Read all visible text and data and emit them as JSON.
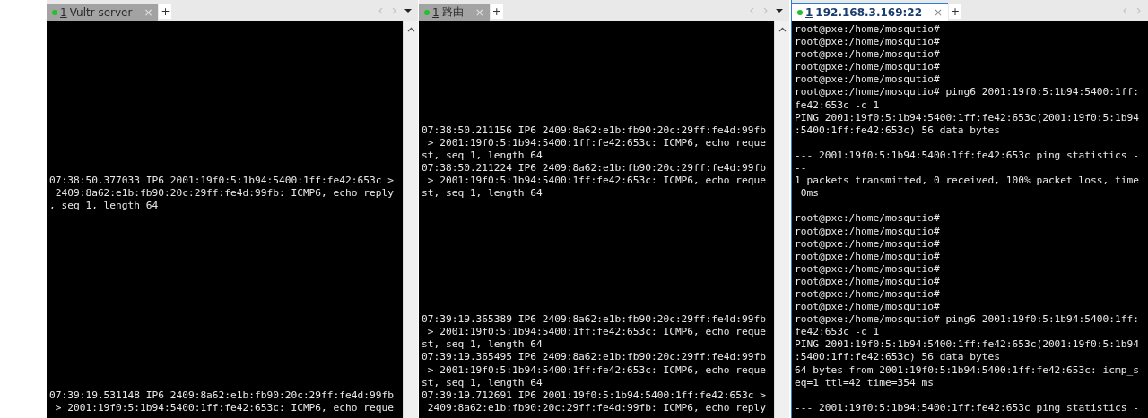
{
  "panes": [
    {
      "tab": {
        "number": "1",
        "label": "Vultr server",
        "selected": false,
        "connected": true,
        "close": "×"
      },
      "new_tab": "+",
      "has_scrollbar": true,
      "has_menu": true,
      "lines": [
        {
          "kind": "blank"
        },
        {
          "kind": "blank"
        },
        {
          "kind": "blank"
        },
        {
          "kind": "blank"
        },
        {
          "kind": "blank"
        },
        {
          "kind": "blank"
        },
        {
          "kind": "blank"
        },
        {
          "kind": "blank"
        },
        {
          "kind": "blank"
        },
        {
          "kind": "blank"
        },
        {
          "kind": "blank"
        },
        {
          "kind": "blank"
        },
        {
          "kind": "text",
          "text": "07:38:50.377033 IP6 2001:19f0:5:1b94:5400:1ff:fe42:653c >"
        },
        {
          "kind": "text",
          "text": " 2409:8a62:e1b:fb90:20c:29ff:fe4d:99fb: ICMP6, echo reply"
        },
        {
          "kind": "text",
          "text": ", seq 1, length 64"
        },
        {
          "kind": "blank"
        },
        {
          "kind": "blank"
        },
        {
          "kind": "blank"
        },
        {
          "kind": "blank"
        },
        {
          "kind": "blank"
        },
        {
          "kind": "blank"
        },
        {
          "kind": "blank"
        },
        {
          "kind": "blank"
        },
        {
          "kind": "blank"
        },
        {
          "kind": "blank"
        },
        {
          "kind": "blank"
        },
        {
          "kind": "blank"
        },
        {
          "kind": "blank"
        },
        {
          "kind": "blank"
        },
        {
          "kind": "text",
          "text": "07:39:19.531148 IP6 2409:8a62:e1b:fb90:20c:29ff:fe4d:99fb"
        },
        {
          "kind": "text",
          "text": " > 2001:19f0:5:1b94:5400:1ff:fe42:653c: ICMP6, echo reque"
        }
      ]
    },
    {
      "tab": {
        "number": "1",
        "label": "路由",
        "selected": false,
        "connected": true,
        "close": "×"
      },
      "new_tab": "+",
      "has_scrollbar": true,
      "has_menu": true,
      "lines": [
        {
          "kind": "blank"
        },
        {
          "kind": "blank"
        },
        {
          "kind": "blank"
        },
        {
          "kind": "blank"
        },
        {
          "kind": "blank"
        },
        {
          "kind": "blank"
        },
        {
          "kind": "blank"
        },
        {
          "kind": "blank"
        },
        {
          "kind": "text",
          "text": "07:38:50.211156 IP6 2409:8a62:e1b:fb90:20c:29ff:fe4d:99fb"
        },
        {
          "kind": "text",
          "text": " > 2001:19f0:5:1b94:5400:1ff:fe42:653c: ICMP6, echo reque"
        },
        {
          "kind": "text",
          "text": "st, seq 1, length 64"
        },
        {
          "kind": "text",
          "text": "07:38:50.211224 IP6 2409:8a62:e1b:fb90:20c:29ff:fe4d:99fb"
        },
        {
          "kind": "text",
          "text": " > 2001:19f0:5:1b94:5400:1ff:fe42:653c: ICMP6, echo reque"
        },
        {
          "kind": "text",
          "text": "st, seq 1, length 64"
        },
        {
          "kind": "blank"
        },
        {
          "kind": "blank"
        },
        {
          "kind": "blank"
        },
        {
          "kind": "blank"
        },
        {
          "kind": "blank"
        },
        {
          "kind": "blank"
        },
        {
          "kind": "blank"
        },
        {
          "kind": "blank"
        },
        {
          "kind": "blank"
        },
        {
          "kind": "text",
          "text": "07:39:19.365389 IP6 2409:8a62:e1b:fb90:20c:29ff:fe4d:99fb"
        },
        {
          "kind": "text",
          "text": " > 2001:19f0:5:1b94:5400:1ff:fe42:653c: ICMP6, echo reque"
        },
        {
          "kind": "text",
          "text": "st, seq 1, length 64"
        },
        {
          "kind": "text",
          "text": "07:39:19.365495 IP6 2409:8a62:e1b:fb90:20c:29ff:fe4d:99fb"
        },
        {
          "kind": "text",
          "text": " > 2001:19f0:5:1b94:5400:1ff:fe42:653c: ICMP6, echo reque"
        },
        {
          "kind": "text",
          "text": "st, seq 1, length 64"
        },
        {
          "kind": "text",
          "text": "07:39:19.712691 IP6 2001:19f0:5:1b94:5400:1ff:fe42:653c >"
        },
        {
          "kind": "text",
          "text": " 2409:8a62:e1b:fb90:20c:29ff:fe4d:99fb: ICMP6, echo reply"
        }
      ]
    },
    {
      "tab": {
        "number": "1",
        "label": "192.168.3.169:22",
        "selected": true,
        "connected": true,
        "close": "×"
      },
      "new_tab": "+",
      "has_scrollbar": false,
      "has_menu": false,
      "lines": [
        {
          "kind": "text",
          "text": "root@pxe:/home/mosqutio#"
        },
        {
          "kind": "text",
          "text": "root@pxe:/home/mosqutio#"
        },
        {
          "kind": "text",
          "text": "root@pxe:/home/mosqutio#"
        },
        {
          "kind": "text",
          "text": "root@pxe:/home/mosqutio#"
        },
        {
          "kind": "text",
          "text": "root@pxe:/home/mosqutio#"
        },
        {
          "kind": "text",
          "text": "root@pxe:/home/mosqutio# ping6 2001:19f0:5:1b94:5400:1ff:"
        },
        {
          "kind": "text",
          "text": "fe42:653c -c 1"
        },
        {
          "kind": "text",
          "text": "PING 2001:19f0:5:1b94:5400:1ff:fe42:653c(2001:19f0:5:1b94"
        },
        {
          "kind": "text",
          "text": ":5400:1ff:fe42:653c) 56 data bytes"
        },
        {
          "kind": "blank"
        },
        {
          "kind": "text",
          "text": "--- 2001:19f0:5:1b94:5400:1ff:fe42:653c ping statistics -"
        },
        {
          "kind": "text",
          "text": "--"
        },
        {
          "kind": "text",
          "text": "1 packets transmitted, 0 received, 100% packet loss, time"
        },
        {
          "kind": "text",
          "text": " 0ms"
        },
        {
          "kind": "blank"
        },
        {
          "kind": "text",
          "text": "root@pxe:/home/mosqutio#"
        },
        {
          "kind": "text",
          "text": "root@pxe:/home/mosqutio#"
        },
        {
          "kind": "text",
          "text": "root@pxe:/home/mosqutio#"
        },
        {
          "kind": "text",
          "text": "root@pxe:/home/mosqutio#"
        },
        {
          "kind": "text",
          "text": "root@pxe:/home/mosqutio#"
        },
        {
          "kind": "text",
          "text": "root@pxe:/home/mosqutio#"
        },
        {
          "kind": "text",
          "text": "root@pxe:/home/mosqutio#"
        },
        {
          "kind": "text",
          "text": "root@pxe:/home/mosqutio#"
        },
        {
          "kind": "text",
          "text": "root@pxe:/home/mosqutio# ping6 2001:19f0:5:1b94:5400:1ff:"
        },
        {
          "kind": "text",
          "text": "fe42:653c -c 1"
        },
        {
          "kind": "text",
          "text": "PING 2001:19f0:5:1b94:5400:1ff:fe42:653c(2001:19f0:5:1b94"
        },
        {
          "kind": "text",
          "text": ":5400:1ff:fe42:653c) 56 data bytes"
        },
        {
          "kind": "text",
          "text": "64 bytes from 2001:19f0:5:1b94:5400:1ff:fe42:653c: icmp_s"
        },
        {
          "kind": "text",
          "text": "eq=1 ttl=42 time=354 ms"
        },
        {
          "kind": "blank"
        },
        {
          "kind": "text",
          "text": "--- 2001:19f0:5:1b94:5400:1ff:fe42:653c ping statistics -"
        }
      ]
    }
  ]
}
